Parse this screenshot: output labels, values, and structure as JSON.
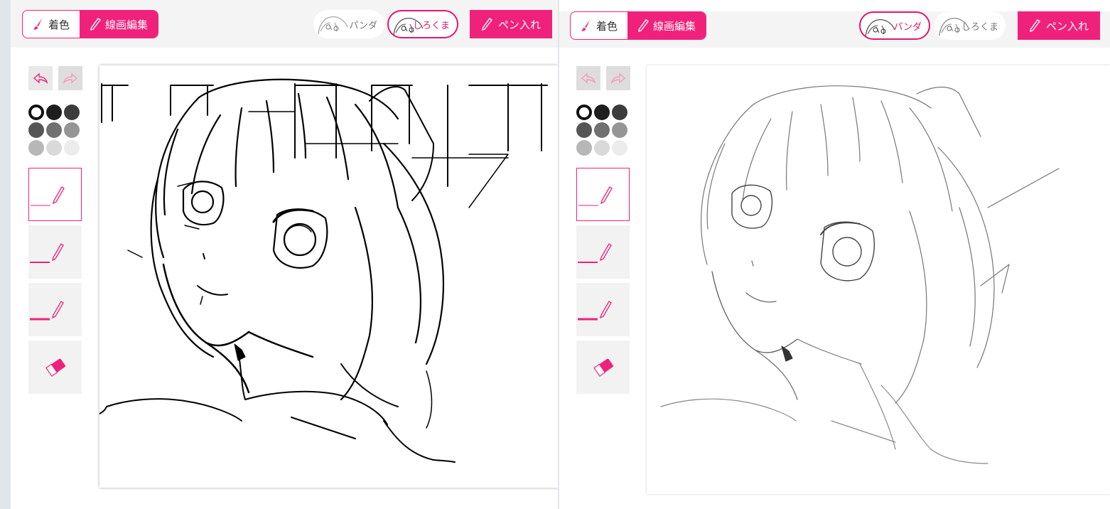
{
  "left_panel": {
    "toolbar": {
      "mode_color_label": "着色",
      "mode_line_label": "線画編集",
      "character_panda_label": "パンダ",
      "character_shirokuma_label": "しろくま",
      "pen_label": "ペン入れ"
    }
  },
  "right_panel": {
    "toolbar": {
      "mode_color_label": "着色",
      "mode_line_label": "線画編集",
      "character_panda_label": "パンダ",
      "character_shirokuma_label": "しろくま",
      "pen_label": "ペン入れ"
    }
  },
  "colors": {
    "accent": "#f0217b",
    "swatches": [
      "#ffffff",
      "#1e1e1e",
      "#3c3c3c",
      "#555555",
      "#707070",
      "#959595",
      "#b7b7b7",
      "#d9d9d9",
      "#ececec"
    ]
  },
  "icons": {
    "undo": "undo-icon",
    "redo": "redo-icon",
    "brush_thin": "pencil-thin-icon",
    "brush_medium": "pencil-medium-icon",
    "brush_thick": "pencil-thick-icon",
    "eraser": "eraser-icon"
  }
}
